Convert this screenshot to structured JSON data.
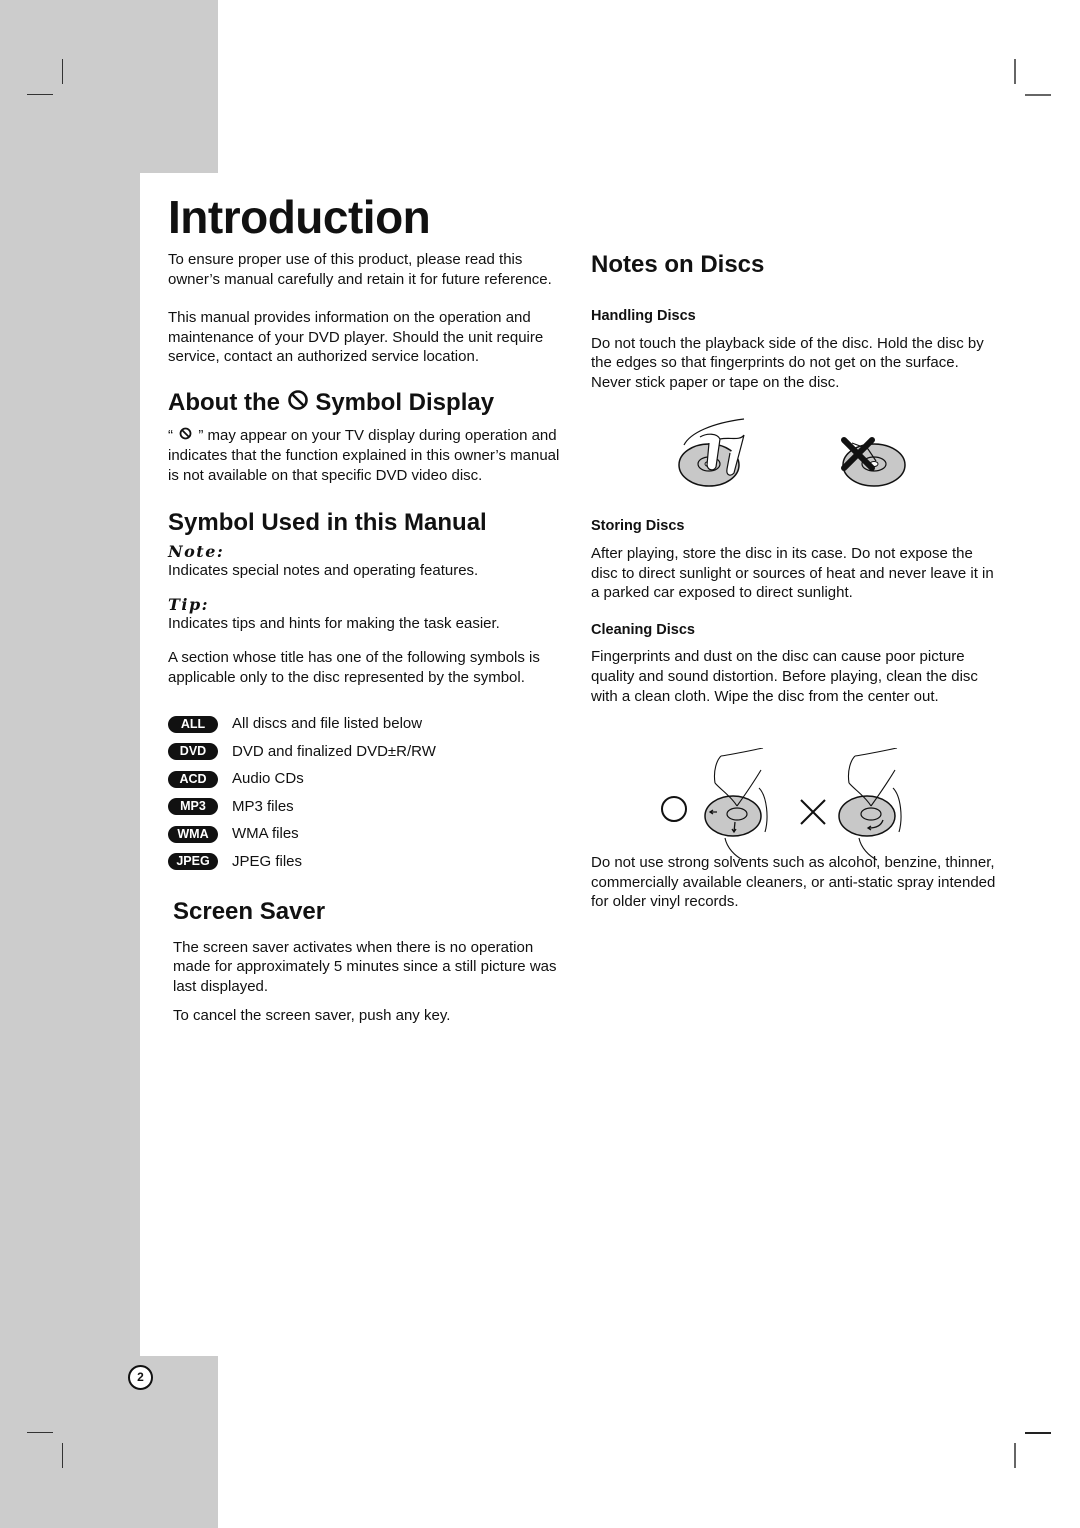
{
  "page": {
    "title": "Introduction",
    "page_number": "2"
  },
  "left": {
    "intro_paragraphs": [
      "To ensure proper use of this product, please read this owner’s manual carefully and retain it for future reference.",
      "This manual provides information on the operation and maintenance of your DVD player. Should the unit require service, contact an authorized service location."
    ],
    "about_symbol": {
      "heading_before": "About the",
      "heading_after": "Symbol Display",
      "icon": "prohibited-icon",
      "quote_open": "“",
      "body_after_icon": "” may appear on your TV display during operation and indicates that the function explained in this owner’s manual is not available on that specific DVD video disc."
    },
    "symbol_used": {
      "heading": "Symbol Used in this Manual",
      "note_label": "Note:",
      "note_text": "Indicates special notes and operating features.",
      "tip_label": "Tip:",
      "tip_text": "Indicates tips and hints for making the task easier.",
      "section_text": "A section whose title has one of the following symbols is applicable only to the disc represented by the symbol.",
      "symbols": [
        {
          "badge": "ALL",
          "label": "All discs and file listed below"
        },
        {
          "badge": "DVD",
          "label": "DVD and finalized DVD±R/RW"
        },
        {
          "badge": "ACD",
          "label": "Audio CDs"
        },
        {
          "badge": "MP3",
          "label": "MP3 files"
        },
        {
          "badge": "WMA",
          "label": "WMA files"
        },
        {
          "badge": "JPEG",
          "label": "JPEG files"
        }
      ]
    },
    "screen_saver": {
      "heading": "Screen Saver",
      "paragraphs": [
        "The screen saver activates when there is no operation made for approximately 5 minutes since a still picture was last displayed.",
        "To cancel the screen saver, push any key."
      ]
    }
  },
  "right": {
    "heading": "Notes on Discs",
    "handling": {
      "heading": "Handling Discs",
      "text": "Do not touch the playback side of the disc. Hold the disc by the edges so that fingerprints do not get on the surface. Never stick paper or tape on the disc."
    },
    "storing": {
      "heading": "Storing Discs",
      "text": "After playing, store the disc in its case. Do not expose the disc to direct sunlight or sources of heat and never leave it in a parked car exposed to direct sunlight."
    },
    "cleaning": {
      "heading": "Cleaning Discs",
      "text": "Fingerprints and dust on the disc can cause poor picture quality and sound distortion. Before playing, clean the disc with a clean cloth. Wipe the disc from the center out.",
      "warning": "Do not use strong solvents such as alcohol, benzine, thinner, commercially available cleaners, or anti-static spray intended for older vinyl records."
    }
  },
  "colors": {
    "margin_gray": "#cccccc",
    "disc_gray": "#c8c8c8",
    "text": "#111111"
  }
}
